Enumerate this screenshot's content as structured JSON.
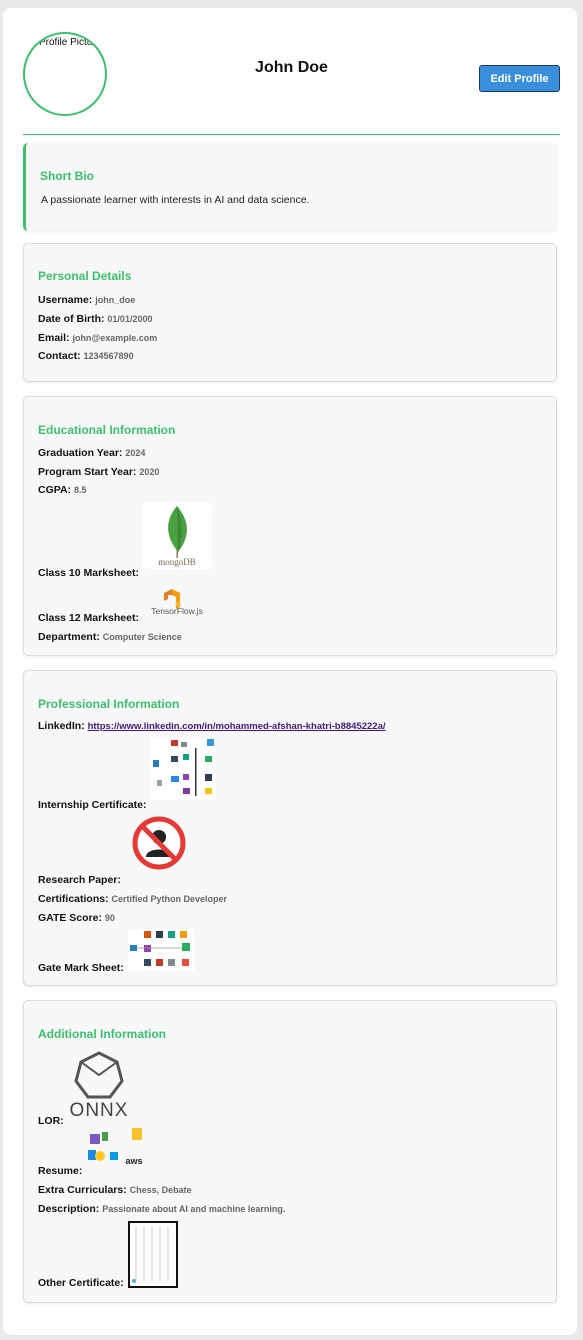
{
  "header": {
    "avatar_alt": "Profile Picture",
    "name": "John Doe",
    "edit_button": "Edit Profile"
  },
  "bio": {
    "title": "Short Bio",
    "text": "A passionate learner with interests in AI and data science."
  },
  "personal": {
    "title": "Personal Details",
    "username_label": "Username:",
    "username": "john_doe",
    "dob_label": "Date of Birth:",
    "dob": "01/01/2000",
    "email_label": "Email:",
    "email": "john@example.com",
    "contact_label": "Contact:",
    "contact": "1234567890"
  },
  "education": {
    "title": "Educational Information",
    "grad_label": "Graduation Year:",
    "grad": "2024",
    "start_label": "Program Start Year:",
    "start": "2020",
    "cgpa_label": "CGPA:",
    "cgpa": "8.5",
    "class10_label": "Class 10 Marksheet:",
    "class12_label": "Class 12 Marksheet:",
    "dept_label": "Department:",
    "dept": "Computer Science",
    "mongo_text": "mongoDB",
    "tf_text": "TensorFlow.js"
  },
  "professional": {
    "title": "Professional Information",
    "linkedin_label": "LinkedIn:",
    "linkedin": "https://www.linkedin.com/in/mohammed-afshan-khatri-b8845222a/",
    "internship_label": "Internship Certificate:",
    "research_label": "Research Paper:",
    "cert_label": "Certifications:",
    "cert": "Certified Python Developer",
    "gate_label": "GATE Score:",
    "gate": "90",
    "gate_sheet_label": "Gate Mark Sheet:"
  },
  "additional": {
    "title": "Additional Information",
    "lor_label": "LOR:",
    "onnx_text": "ONNX",
    "resume_label": "Resume:",
    "aws_text": "aws",
    "extra_label": "Extra Curriculars:",
    "extra": "Chess, Debate",
    "desc_label": "Description:",
    "desc": "Passionate about AI and machine learning.",
    "other_label": "Other Certificate:"
  },
  "colors": {
    "accent": "#3dbf6d",
    "button": "#3a8fdd",
    "link": "#3b1a80"
  }
}
